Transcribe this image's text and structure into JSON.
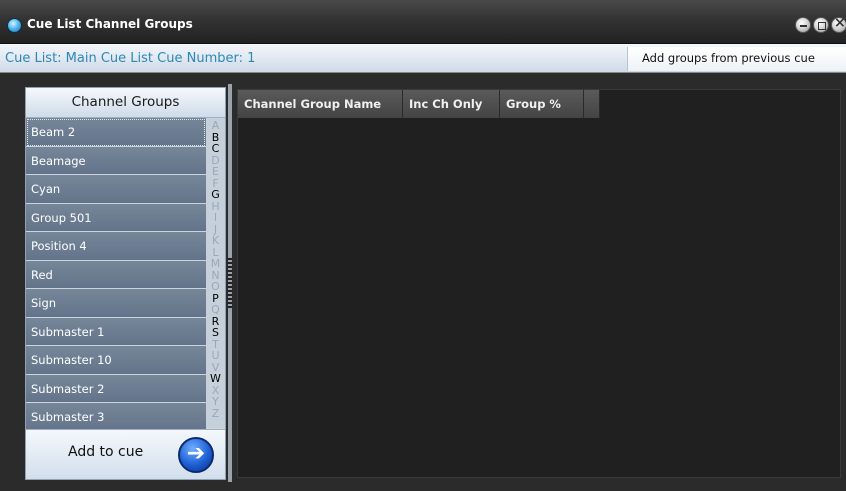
{
  "window": {
    "title": "Cue List Channel Groups"
  },
  "info_bar": {
    "cue_info": "Cue List: Main Cue List Cue Number: 1",
    "add_previous_label": "Add groups from previous cue"
  },
  "groups_panel": {
    "header": "Channel Groups",
    "items": [
      {
        "label": "Beam 2"
      },
      {
        "label": "Beamage"
      },
      {
        "label": "Cyan"
      },
      {
        "label": "Group 501"
      },
      {
        "label": "Position 4"
      },
      {
        "label": "Red"
      },
      {
        "label": "Sign"
      },
      {
        "label": "Submaster 1"
      },
      {
        "label": "Submaster 10"
      },
      {
        "label": "Submaster 2"
      },
      {
        "label": "Submaster 3"
      }
    ],
    "alphabet": [
      {
        "letter": "A",
        "active": false
      },
      {
        "letter": "B",
        "active": true
      },
      {
        "letter": "C",
        "active": true
      },
      {
        "letter": "D",
        "active": false
      },
      {
        "letter": "E",
        "active": false
      },
      {
        "letter": "F",
        "active": false
      },
      {
        "letter": "G",
        "active": true
      },
      {
        "letter": "H",
        "active": false
      },
      {
        "letter": "I",
        "active": false
      },
      {
        "letter": "J",
        "active": false
      },
      {
        "letter": "K",
        "active": false
      },
      {
        "letter": "L",
        "active": false
      },
      {
        "letter": "M",
        "active": false
      },
      {
        "letter": "N",
        "active": false
      },
      {
        "letter": "O",
        "active": false
      },
      {
        "letter": "P",
        "active": true
      },
      {
        "letter": "Q",
        "active": false
      },
      {
        "letter": "R",
        "active": true
      },
      {
        "letter": "S",
        "active": true
      },
      {
        "letter": "T",
        "active": false
      },
      {
        "letter": "U",
        "active": false
      },
      {
        "letter": "V",
        "active": false
      },
      {
        "letter": "W",
        "active": true
      },
      {
        "letter": "X",
        "active": false
      },
      {
        "letter": "Y",
        "active": false
      },
      {
        "letter": "Z",
        "active": false
      }
    ],
    "add_to_cue_label": "Add to cue",
    "add_to_cue_icon": "arrow-right-circle-icon"
  },
  "table": {
    "columns": [
      {
        "label": "Channel Group Name"
      },
      {
        "label": "Inc Ch Only"
      },
      {
        "label": "Group %"
      }
    ],
    "rows": []
  }
}
